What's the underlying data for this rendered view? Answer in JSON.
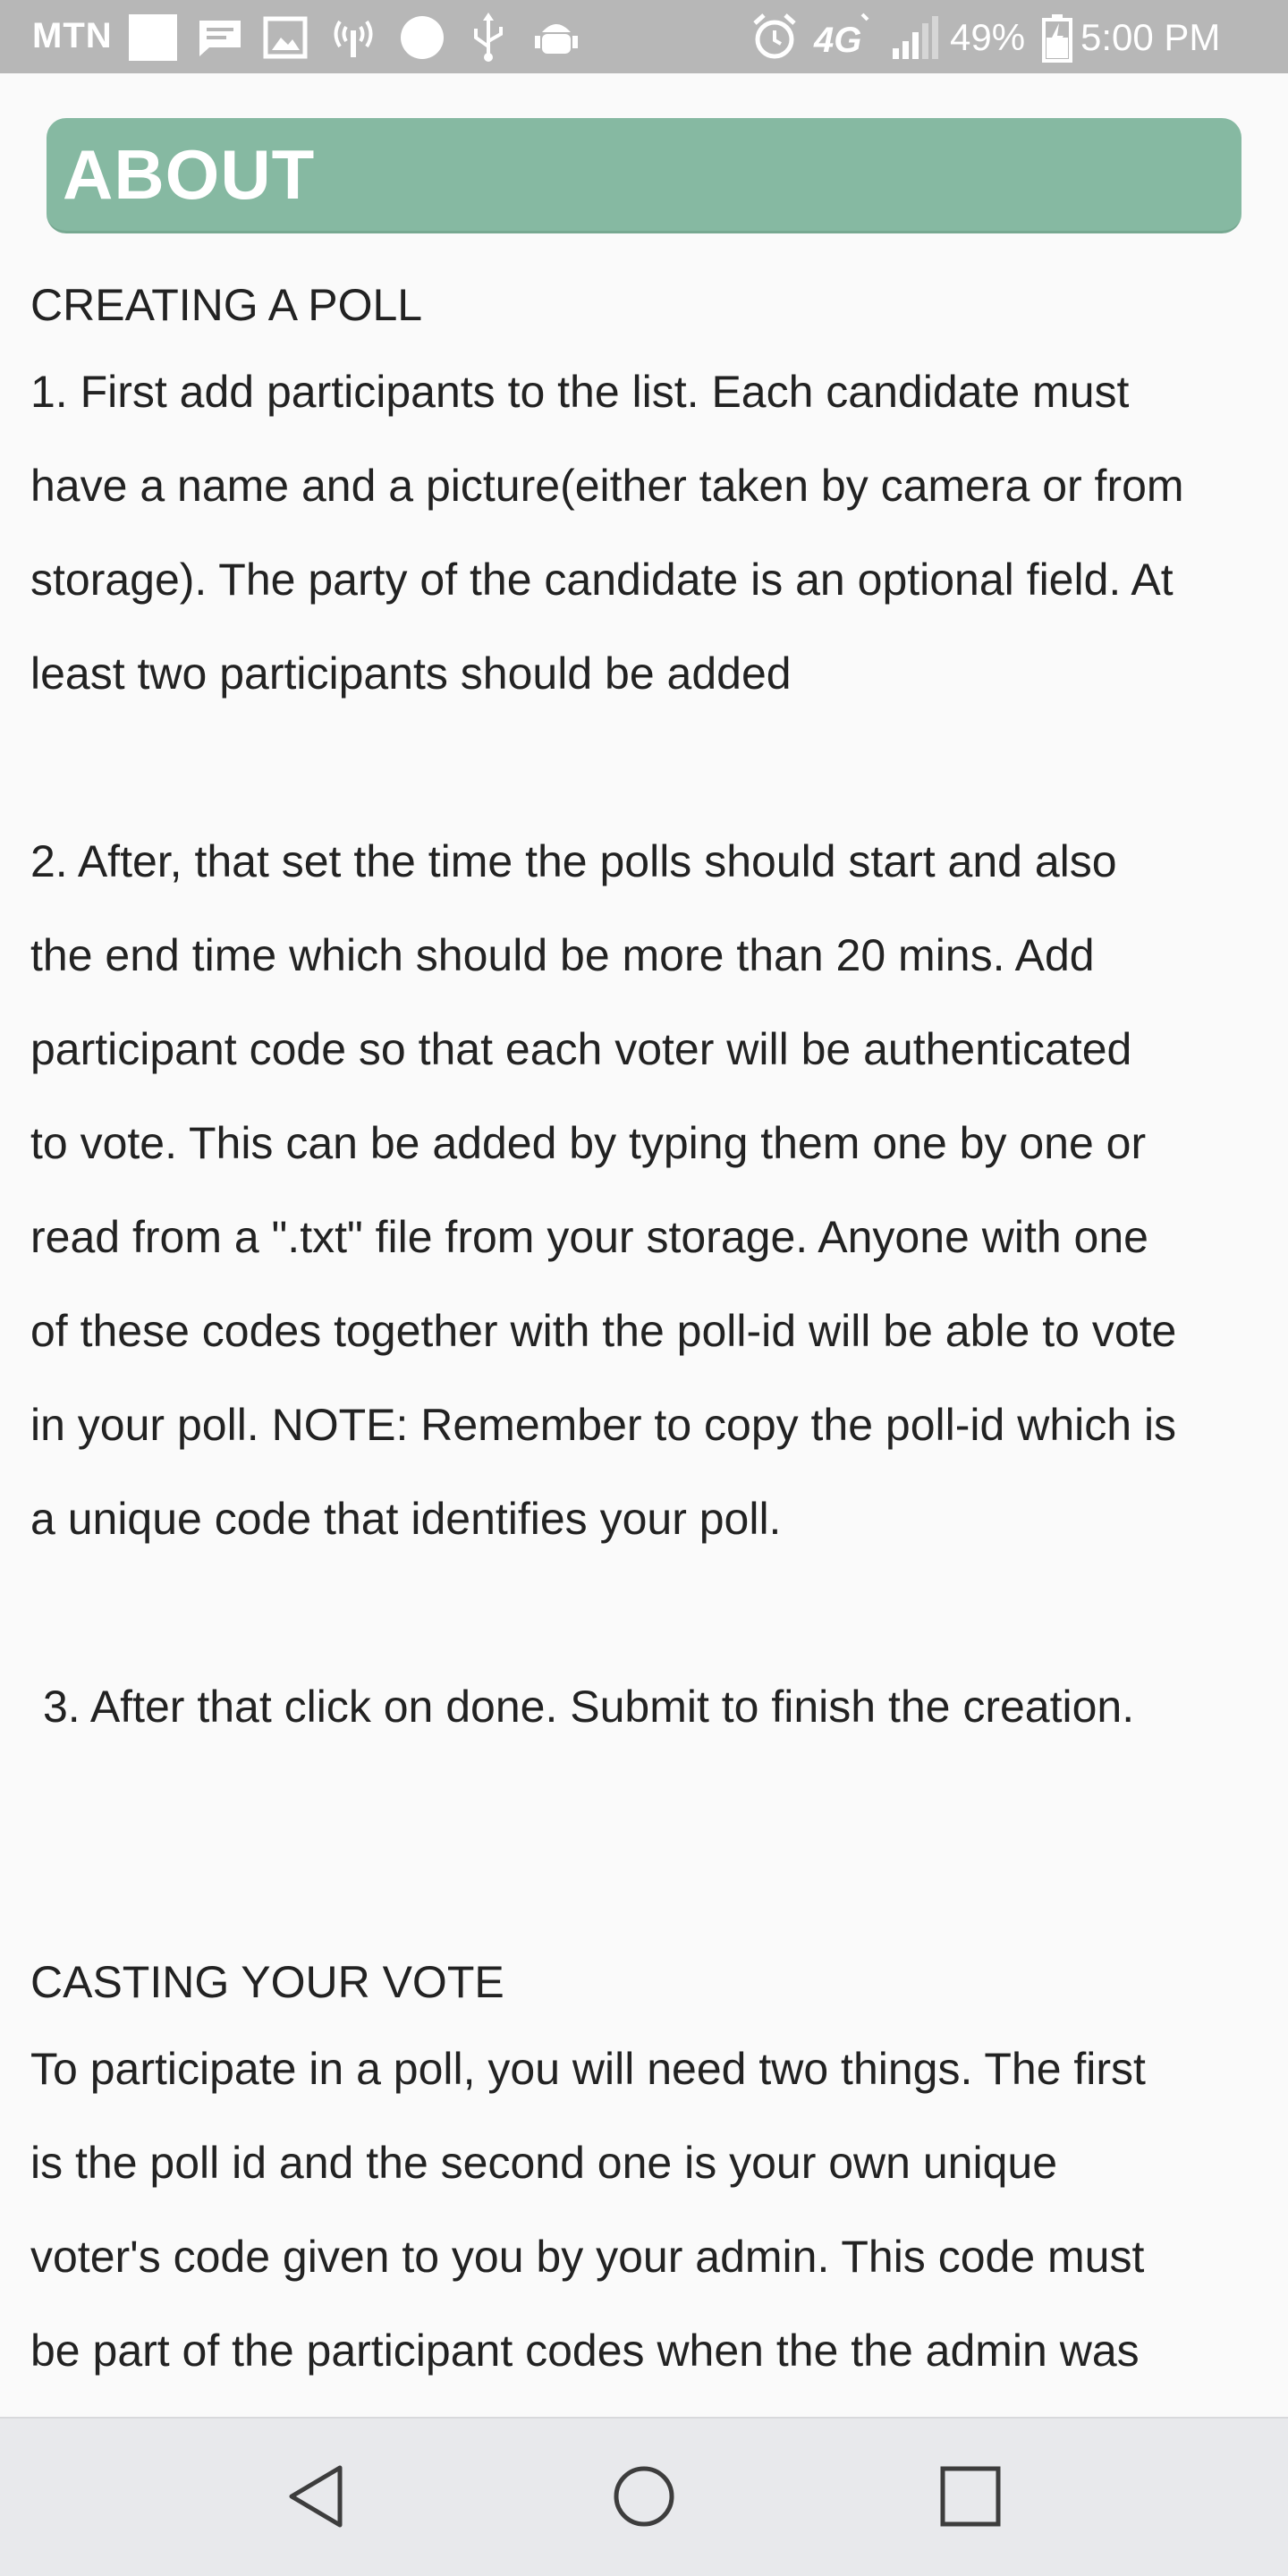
{
  "status_bar": {
    "carrier": "MTN",
    "battery": "49%",
    "time": "5:00 PM",
    "network": "4G",
    "icons": [
      "sim-icon",
      "message-icon",
      "image-icon",
      "hotspot-icon",
      "circle-icon",
      "usb-icon",
      "android-debug-icon",
      "alarm-icon",
      "network-4g-icon",
      "signal-icon",
      "battery-icon"
    ]
  },
  "header": {
    "title": "ABOUT",
    "color": "#86b9a2"
  },
  "about": {
    "creating": {
      "heading": "CREATING A POLL",
      "step1": "1. First add participants to the list. Each candidate must\nhave a name and a picture(either taken by camera or from\nstorage). The party of the candidate is an optional field. At\nleast two participants should be added",
      "step2": "2. After, that set the time the polls should start and also\nthe end time which should be more than 20 mins. Add\nparticipant code so that each voter will be authenticated\nto vote. This can be added by typing them one by one or\nread from a \".txt\" file from your storage. Anyone with one\nof these codes together with the poll-id will be able to vote\nin your poll. NOTE: Remember to copy the poll-id which is\na unique code that identifies your poll.",
      "step3": "3. After that click on done. Submit to finish the creation."
    },
    "casting": {
      "heading": "CASTING YOUR VOTE",
      "body": "To participate in a poll, you will need two things. The first\nis the poll id and the second one is your own unique\nvoter's code given to you by your admin. This code must\nbe part of the participant codes when the the admin was"
    }
  },
  "nav_bar": {
    "icons": [
      "back-icon",
      "home-icon",
      "recents-icon"
    ]
  }
}
